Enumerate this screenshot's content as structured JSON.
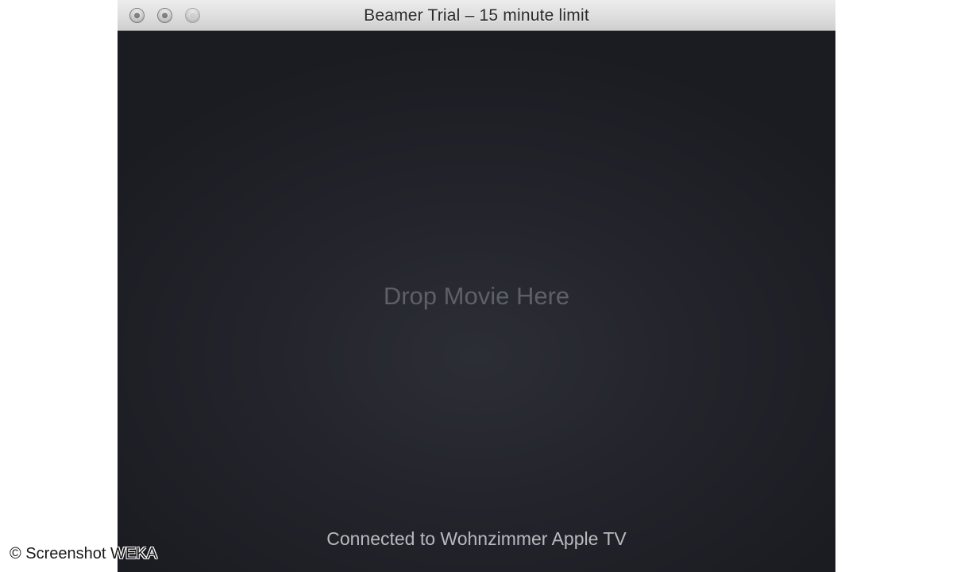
{
  "window": {
    "title": "Beamer Trial – 15 minute limit"
  },
  "main": {
    "drop_prompt": "Drop Movie Here",
    "connection_status": "Connected to Wohnzimmer Apple TV"
  },
  "watermark": {
    "text": "© Screenshot WEKA"
  },
  "colors": {
    "window_background": "#1d1e24",
    "titlebar": "#dedede"
  }
}
